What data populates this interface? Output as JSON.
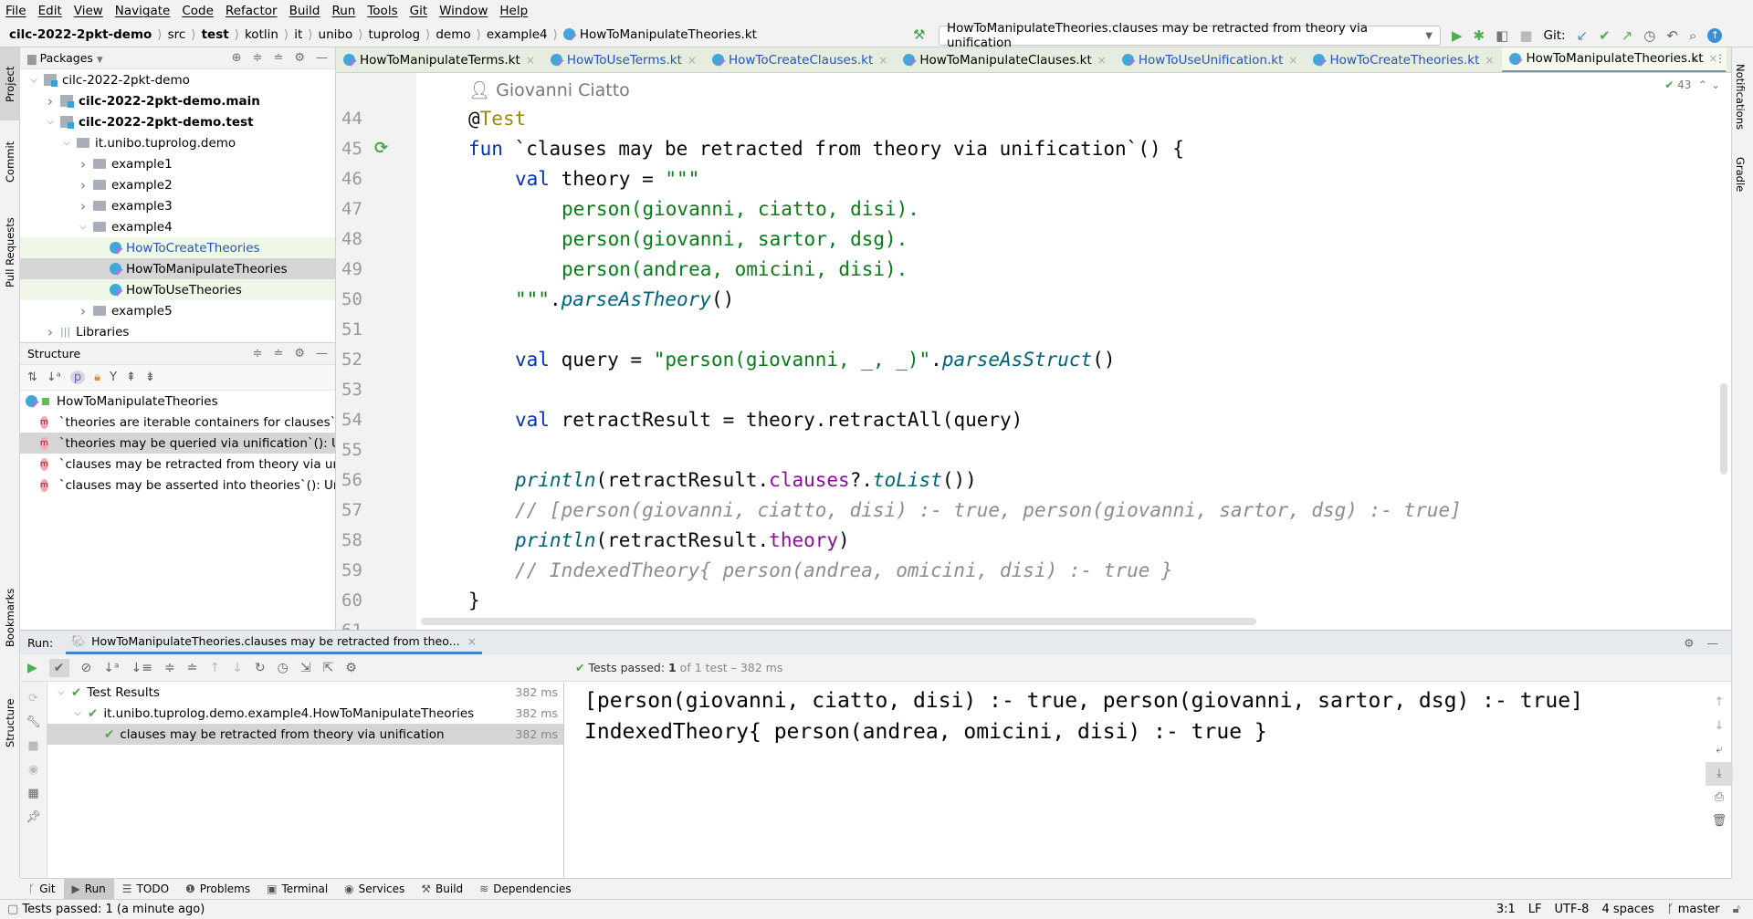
{
  "menu": [
    "File",
    "Edit",
    "View",
    "Navigate",
    "Code",
    "Refactor",
    "Build",
    "Run",
    "Tools",
    "Git",
    "Window",
    "Help"
  ],
  "breadcrumb": [
    {
      "t": "cilc-2022-2pkt-demo",
      "b": true
    },
    {
      "t": "src"
    },
    {
      "t": "test",
      "b": true
    },
    {
      "t": "kotlin"
    },
    {
      "t": "it"
    },
    {
      "t": "unibo"
    },
    {
      "t": "tuprolog"
    },
    {
      "t": "demo"
    },
    {
      "t": "example4"
    },
    {
      "t": "HowToManipulateTheories.kt",
      "kt": true
    }
  ],
  "run_config": "HowToManipulateTheories.clauses may be retracted from theory via unification",
  "git_label": "Git:",
  "left_strip": [
    "Project",
    "Commit",
    "Pull Requests",
    "Bookmarks",
    "Structure"
  ],
  "right_strip": [
    "Notifications",
    "Gradle"
  ],
  "project": {
    "title": "Packages",
    "items": [
      {
        "label": "cilc-2022-2pkt-demo",
        "depth": 0,
        "arrow": "down",
        "icon": "module"
      },
      {
        "label": "cilc-2022-2pkt-demo.main",
        "depth": 1,
        "arrow": "right",
        "icon": "module",
        "bold": true
      },
      {
        "label": "cilc-2022-2pkt-demo.test",
        "depth": 1,
        "arrow": "down",
        "icon": "module",
        "bold": true
      },
      {
        "label": "it.unibo.tuprolog.demo",
        "depth": 2,
        "arrow": "down",
        "icon": "package"
      },
      {
        "label": "example1",
        "depth": 3,
        "arrow": "right",
        "icon": "package"
      },
      {
        "label": "example2",
        "depth": 3,
        "arrow": "right",
        "icon": "package"
      },
      {
        "label": "example3",
        "depth": 3,
        "arrow": "right",
        "icon": "package"
      },
      {
        "label": "example4",
        "depth": 3,
        "arrow": "down",
        "icon": "package"
      },
      {
        "label": "HowToCreateTheories",
        "depth": 4,
        "icon": "kotlin",
        "state": "green",
        "blue": true
      },
      {
        "label": "HowToManipulateTheories",
        "depth": 4,
        "icon": "kotlin",
        "state": "sel"
      },
      {
        "label": "HowToUseTheories",
        "depth": 4,
        "icon": "kotlin",
        "state": "green"
      },
      {
        "label": "example5",
        "depth": 3,
        "arrow": "right",
        "icon": "package"
      },
      {
        "label": "Libraries",
        "depth": 1,
        "arrow": "right",
        "icon": "library"
      }
    ]
  },
  "structure": {
    "title": "Structure",
    "root": "HowToManipulateTheories",
    "items": [
      "`theories are iterable containers for clauses`(): Unit",
      "`theories may be queried via unification`(): Unit",
      "`clauses may be retracted from theory via unification`(): Unit",
      "`clauses may be asserted into theories`(): Unit"
    ],
    "selected": 1
  },
  "tabs": [
    {
      "label": "HowToManipulateTerms.kt"
    },
    {
      "label": "HowToUseTerms.kt",
      "blue": true
    },
    {
      "label": "HowToCreateClauses.kt",
      "blue": true
    },
    {
      "label": "HowToManipulateClauses.kt"
    },
    {
      "label": "HowToUseUnification.kt",
      "blue": true
    },
    {
      "label": "HowToCreateTheories.kt",
      "blue": true
    },
    {
      "label": "HowToManipulateTheories.kt",
      "active": true
    }
  ],
  "editor": {
    "author": "Giovanni Ciatto",
    "inspections": "43",
    "lines": [
      {
        "n": "44",
        "indent": 0,
        "seg": [
          [
            "@",
            "id"
          ],
          [
            "Test",
            "ann"
          ]
        ]
      },
      {
        "n": "45",
        "indent": 0,
        "seg": [
          [
            "fun ",
            "kw"
          ],
          [
            "`clauses may be retracted from theory via unification`",
            "id"
          ],
          [
            "() {",
            "id"
          ]
        ]
      },
      {
        "n": "46",
        "indent": 1,
        "seg": [
          [
            "val ",
            "kw"
          ],
          [
            "theory = ",
            "id"
          ],
          [
            "\"\"\"",
            "str"
          ]
        ]
      },
      {
        "n": "47",
        "indent": 2,
        "seg": [
          [
            "person(giovanni, ciatto, disi).",
            "str"
          ]
        ]
      },
      {
        "n": "48",
        "indent": 2,
        "seg": [
          [
            "person(giovanni, sartor, dsg).",
            "str"
          ]
        ]
      },
      {
        "n": "49",
        "indent": 2,
        "seg": [
          [
            "person(andrea, omicini, disi).",
            "str"
          ]
        ]
      },
      {
        "n": "50",
        "indent": 1,
        "seg": [
          [
            "\"\"\"",
            "str"
          ],
          [
            ".",
            "id"
          ],
          [
            "parseAsTheory",
            "fn"
          ],
          [
            "()",
            "id"
          ]
        ]
      },
      {
        "n": "51",
        "indent": 0,
        "seg": []
      },
      {
        "n": "52",
        "indent": 1,
        "seg": [
          [
            "val ",
            "kw"
          ],
          [
            "query = ",
            "id"
          ],
          [
            "\"person(giovanni, _, _)\"",
            "str"
          ],
          [
            ".",
            "id"
          ],
          [
            "parseAsStruct",
            "fn"
          ],
          [
            "()",
            "id"
          ]
        ]
      },
      {
        "n": "53",
        "indent": 0,
        "seg": []
      },
      {
        "n": "54",
        "indent": 1,
        "seg": [
          [
            "val ",
            "kw"
          ],
          [
            "retractResult = theory.retractAll(query)",
            "id"
          ]
        ]
      },
      {
        "n": "55",
        "indent": 0,
        "seg": []
      },
      {
        "n": "56",
        "indent": 1,
        "seg": [
          [
            "println",
            "fn"
          ],
          [
            "(retractResult.",
            "id"
          ],
          [
            "clauses",
            "prop"
          ],
          [
            "?.",
            "id"
          ],
          [
            "toList",
            "fn"
          ],
          [
            "())",
            "id"
          ]
        ]
      },
      {
        "n": "57",
        "indent": 1,
        "seg": [
          [
            "// [person(giovanni, ciatto, disi) :- true, person(giovanni, sartor, dsg) :- true]",
            "cm"
          ]
        ]
      },
      {
        "n": "58",
        "indent": 1,
        "seg": [
          [
            "println",
            "fn"
          ],
          [
            "(retractResult.",
            "id"
          ],
          [
            "theory",
            "prop"
          ],
          [
            ")",
            "id"
          ]
        ]
      },
      {
        "n": "59",
        "indent": 1,
        "seg": [
          [
            "// IndexedTheory{ person(andrea, omicini, disi) :- true }",
            "cm"
          ]
        ]
      },
      {
        "n": "60",
        "indent": 0,
        "seg": [
          [
            "}",
            "id"
          ]
        ]
      },
      {
        "n": "61",
        "indent": 0,
        "seg": []
      }
    ]
  },
  "run": {
    "label": "Run:",
    "tab": "HowToManipulateTheories.clauses may be retracted from theo...",
    "status_bold": "Tests passed: ",
    "status_count": "1",
    "status_rest": " of 1 test – 382 ms",
    "tree": [
      {
        "label": "Test Results",
        "ms": "382 ms",
        "depth": 0
      },
      {
        "label": "it.unibo.tuprolog.demo.example4.HowToManipulateTheories",
        "ms": "382 ms",
        "depth": 1
      },
      {
        "label": "clauses may be retracted from theory via unification",
        "ms": "382 ms",
        "depth": 2,
        "sel": true
      }
    ],
    "output": [
      "[person(giovanni, ciatto, disi) :- true, person(giovanni, sartor, dsg) :- true]",
      "IndexedTheory{ person(andrea, omicini, disi) :- true }"
    ]
  },
  "toolwindows": [
    {
      "label": "Git",
      "icon": "ᚴ"
    },
    {
      "label": "Run",
      "icon": "▶",
      "active": true
    },
    {
      "label": "TODO",
      "icon": "☰"
    },
    {
      "label": "Problems",
      "icon": "❶"
    },
    {
      "label": "Terminal",
      "icon": "▣"
    },
    {
      "label": "Services",
      "icon": "◉"
    },
    {
      "label": "Build",
      "icon": "⚒"
    },
    {
      "label": "Dependencies",
      "icon": "≋"
    }
  ],
  "status": {
    "message": "Tests passed: 1 (a minute ago)",
    "position": "3:1",
    "line_sep": "LF",
    "encoding": "UTF-8",
    "indent": "4 spaces",
    "branch": "master"
  }
}
